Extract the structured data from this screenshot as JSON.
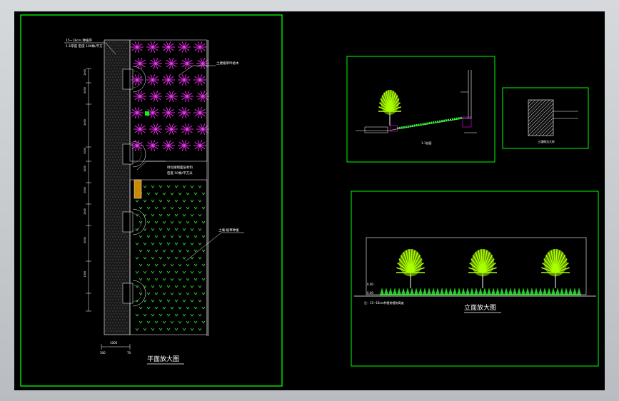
{
  "drawing": {
    "background": "#000000",
    "frame_color": "#00ff00",
    "plan": {
      "title": "平面放大图",
      "note_top": "15~18cm 种植带",
      "note_top2": "1:1厚度 密度 100株/平方",
      "note_flower": "土建植草坪格木",
      "note_shrub": "绿化植物面层材料",
      "note_shrub2": "密度 50株/平方米",
      "note_lawn": "土壤-植草种植",
      "dims_left": [
        "1000",
        "4000",
        "1000",
        "2000",
        "1000",
        "2000",
        "1000",
        "4000",
        "1000"
      ],
      "dims_bottom": [
        "1000",
        "300",
        "70"
      ]
    },
    "section": {
      "caption": "1-1剖面"
    },
    "detail": {
      "caption": "土壤做法大样"
    },
    "elevation": {
      "title": "立面放大图",
      "note": "注：15~18cm种植带植物高度",
      "levels": [
        "0.00",
        "0.00"
      ]
    },
    "colors": {
      "flower": "#ff33ff",
      "grass": "#33ff33",
      "tree": "#aaff00",
      "white": "#ffffff",
      "magenta": "#ff00ff",
      "orange": "#cc8800"
    }
  }
}
